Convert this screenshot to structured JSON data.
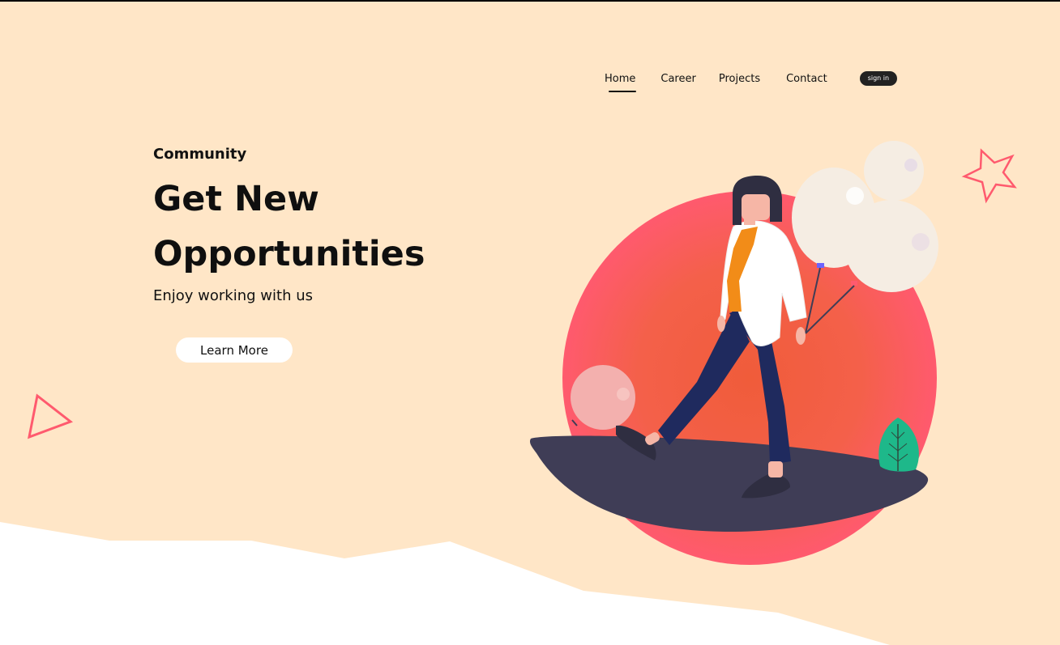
{
  "nav": {
    "items": [
      {
        "label": "Home",
        "active": true
      },
      {
        "label": "Career"
      },
      {
        "label": "Projects"
      },
      {
        "label": "Contact"
      }
    ],
    "signin_label": "sign in"
  },
  "hero": {
    "kicker": "Community",
    "title_line1": "Get New",
    "title_line2": "Opportunities",
    "subtitle": "Enjoy working with us",
    "cta_label": "Learn More"
  },
  "colors": {
    "background": "#ffe6c7",
    "accent": "#ff5a6e",
    "circle_center": "#f26540",
    "platform": "#3f3d56",
    "leaf": "#1eb88a",
    "navy": "#1f2a5e",
    "balloon": "#f5ede3",
    "text": "#111111"
  },
  "decorations": {
    "icons": [
      "triangle-outline-icon",
      "star-outline-icon",
      "leaf-icon",
      "balloon-icon"
    ]
  }
}
